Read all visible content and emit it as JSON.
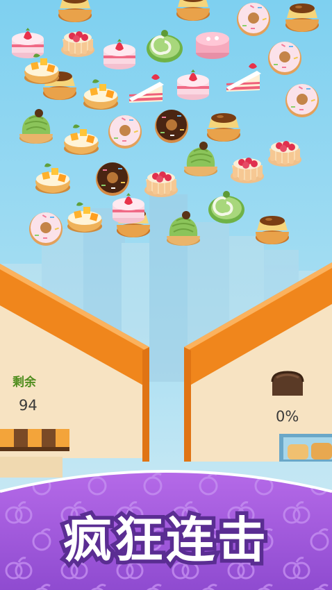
{
  "colors": {
    "sky_top": "#7ed0f0",
    "sky_bottom": "#cfeaf5",
    "roof_orange": "#f0861c",
    "wall_cream": "#f8e3c0",
    "banner_purple": "#a85ee0",
    "banner_text_outline": "#5a2d92",
    "remaining_label_green": "#4f8d1e"
  },
  "hud": {
    "remaining_label": "剩余",
    "remaining_count": "94",
    "progress_percent": "0%",
    "progress_value": 0
  },
  "banner": {
    "title": "疯狂连击"
  },
  "desserts": [
    {
      "type": "flan-tart"
    },
    {
      "type": "flan-tart"
    },
    {
      "type": "donut-pink"
    },
    {
      "type": "flan-tart"
    },
    {
      "type": "strawberry-cake"
    },
    {
      "type": "raspberry-charlotte"
    },
    {
      "type": "strawberry-cake"
    },
    {
      "type": "matcha-roll"
    },
    {
      "type": "pink-mousse"
    },
    {
      "type": "donut-pink"
    },
    {
      "type": "flan-tart"
    },
    {
      "type": "mango-tart"
    },
    {
      "type": "cake-slice"
    },
    {
      "type": "strawberry-cake"
    },
    {
      "type": "cake-slice"
    },
    {
      "type": "donut-pink"
    },
    {
      "type": "matcha-mont-blanc"
    },
    {
      "type": "mango-tart"
    },
    {
      "type": "donut-pink"
    },
    {
      "type": "donut-chocolate"
    },
    {
      "type": "flan-tart"
    },
    {
      "type": "raspberry-charlotte"
    },
    {
      "type": "mango-tart"
    },
    {
      "type": "donut-chocolate"
    },
    {
      "type": "raspberry-charlotte"
    },
    {
      "type": "matcha-mont-blanc"
    },
    {
      "type": "raspberry-charlotte"
    },
    {
      "type": "donut-pink"
    },
    {
      "type": "mango-tart"
    },
    {
      "type": "flan-tart"
    },
    {
      "type": "matcha-mont-blanc"
    },
    {
      "type": "matcha-roll"
    },
    {
      "type": "flan-tart"
    },
    {
      "type": "mango-tart"
    },
    {
      "type": "strawberry-cake"
    }
  ]
}
